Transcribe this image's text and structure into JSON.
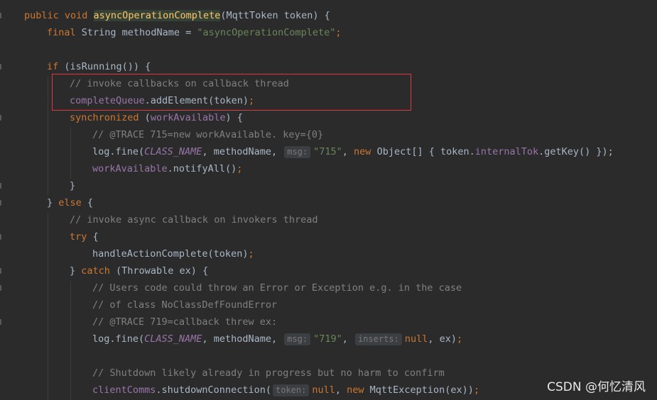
{
  "code_lines": [
    {
      "tokens": [
        {
          "t": "public void ",
          "c": "kw"
        },
        {
          "t": "asyncOperationComplete",
          "c": "fn-hl"
        },
        {
          "t": "(MqttToken token) {",
          "c": "br"
        }
      ]
    },
    {
      "tokens": [
        {
          "t": "final ",
          "c": "kw"
        },
        {
          "t": "String methodName = ",
          "c": "br"
        },
        {
          "t": "\"asyncOperationComplete\"",
          "c": "str"
        },
        {
          "t": ";",
          "c": "kw"
        }
      ]
    },
    {
      "tokens": []
    },
    {
      "tokens": [
        {
          "t": "if ",
          "c": "kw"
        },
        {
          "t": "(isRunning()) {",
          "c": "br"
        }
      ]
    },
    {
      "tokens": [
        {
          "t": "// invoke callbacks on callback thread",
          "c": "cmt"
        }
      ]
    },
    {
      "tokens": [
        {
          "t": "completeQueue",
          "c": "fld"
        },
        {
          "t": ".addElement(token)",
          "c": "br"
        },
        {
          "t": ";",
          "c": "kw"
        }
      ]
    },
    {
      "tokens": [
        {
          "t": "synchronized ",
          "c": "kw"
        },
        {
          "t": "(",
          "c": "br"
        },
        {
          "t": "workAvailable",
          "c": "fld"
        },
        {
          "t": ") {",
          "c": "br"
        }
      ]
    },
    {
      "tokens": [
        {
          "t": "// @TRACE 715=new workAvailable. key={0}",
          "c": "cmt"
        }
      ]
    },
    {
      "tokens": [
        {
          "t": "log.fine(",
          "c": "br"
        },
        {
          "t": "CLASS_NAME",
          "c": "const"
        },
        {
          "t": ", methodName, ",
          "c": "br"
        },
        {
          "t": "msg:",
          "c": "hint"
        },
        {
          "t": "\"715\"",
          "c": "str"
        },
        {
          "t": ", ",
          "c": "br"
        },
        {
          "t": "new ",
          "c": "kw"
        },
        {
          "t": "Object[] { token.",
          "c": "br"
        },
        {
          "t": "internalTok",
          "c": "fld"
        },
        {
          "t": ".getKey() });",
          "c": "br"
        }
      ]
    },
    {
      "tokens": [
        {
          "t": "workAvailable",
          "c": "fld"
        },
        {
          "t": ".notifyAll()",
          "c": "br"
        },
        {
          "t": ";",
          "c": "kw"
        }
      ]
    },
    {
      "tokens": [
        {
          "t": "}",
          "c": "br"
        }
      ]
    },
    {
      "tokens": [
        {
          "t": "} ",
          "c": "br"
        },
        {
          "t": "else ",
          "c": "kw"
        },
        {
          "t": "{",
          "c": "br"
        }
      ]
    },
    {
      "tokens": [
        {
          "t": "// invoke async callback on invokers thread",
          "c": "cmt"
        }
      ]
    },
    {
      "tokens": [
        {
          "t": "try ",
          "c": "kw"
        },
        {
          "t": "{",
          "c": "br"
        }
      ]
    },
    {
      "tokens": [
        {
          "t": "handleActionComplete(token)",
          "c": "br"
        },
        {
          "t": ";",
          "c": "kw"
        }
      ]
    },
    {
      "tokens": [
        {
          "t": "} ",
          "c": "br"
        },
        {
          "t": "catch ",
          "c": "kw"
        },
        {
          "t": "(Throwable ex) {",
          "c": "br"
        }
      ]
    },
    {
      "tokens": [
        {
          "t": "// Users code could throw an Error or Exception e.g. in the case",
          "c": "cmt"
        }
      ]
    },
    {
      "tokens": [
        {
          "t": "// of class NoClassDefFoundError",
          "c": "cmt"
        }
      ]
    },
    {
      "tokens": [
        {
          "t": "// @TRACE 719=callback threw ex:",
          "c": "cmt"
        }
      ]
    },
    {
      "tokens": [
        {
          "t": "log.fine(",
          "c": "br"
        },
        {
          "t": "CLASS_NAME",
          "c": "const"
        },
        {
          "t": ", methodName, ",
          "c": "br"
        },
        {
          "t": "msg:",
          "c": "hint"
        },
        {
          "t": "\"719\"",
          "c": "str"
        },
        {
          "t": ", ",
          "c": "br"
        },
        {
          "t": "inserts:",
          "c": "hint"
        },
        {
          "t": "null",
          "c": "kw"
        },
        {
          "t": ", ex)",
          "c": "br"
        },
        {
          "t": ";",
          "c": "kw"
        }
      ]
    },
    {
      "tokens": []
    },
    {
      "tokens": [
        {
          "t": "// Shutdown likely already in progress but no harm to confirm",
          "c": "cmt"
        }
      ]
    },
    {
      "tokens": [
        {
          "t": "clientComms",
          "c": "fld"
        },
        {
          "t": ".shutdownConnection(",
          "c": "br"
        },
        {
          "t": "token:",
          "c": "hint"
        },
        {
          "t": "null",
          "c": "kw"
        },
        {
          "t": ", ",
          "c": "br"
        },
        {
          "t": "new ",
          "c": "kw"
        },
        {
          "t": "MqttException(ex))",
          "c": "br"
        },
        {
          "t": ";",
          "c": "kw"
        }
      ]
    }
  ],
  "watermark": "CSDN @何忆清风"
}
